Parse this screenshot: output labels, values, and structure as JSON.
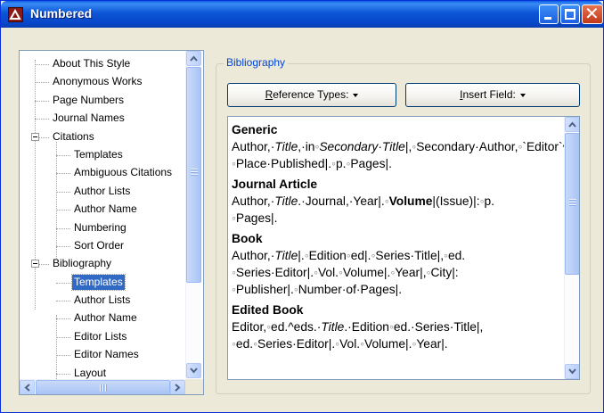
{
  "window": {
    "title": "Numbered"
  },
  "tree": {
    "items": [
      {
        "label": "About This Style",
        "level": 1
      },
      {
        "label": "Anonymous Works",
        "level": 1
      },
      {
        "label": "Page Numbers",
        "level": 1
      },
      {
        "label": "Journal Names",
        "level": 1
      },
      {
        "label": "Citations",
        "level": 0,
        "expanded": true
      },
      {
        "label": "Templates",
        "level": 2
      },
      {
        "label": "Ambiguous Citations",
        "level": 2
      },
      {
        "label": "Author Lists",
        "level": 2
      },
      {
        "label": "Author Name",
        "level": 2
      },
      {
        "label": "Numbering",
        "level": 2
      },
      {
        "label": "Sort Order",
        "level": 2
      },
      {
        "label": "Bibliography",
        "level": 0,
        "expanded": true
      },
      {
        "label": "Templates",
        "level": 2,
        "selected": true
      },
      {
        "label": "Author Lists",
        "level": 2
      },
      {
        "label": "Author Name",
        "level": 2
      },
      {
        "label": "Editor Lists",
        "level": 2
      },
      {
        "label": "Editor Names",
        "level": 2
      },
      {
        "label": "Layout",
        "level": 2
      }
    ]
  },
  "group": {
    "label": "Bibliography"
  },
  "buttons": {
    "reference_types_underlined": "R",
    "reference_types_rest": "eference Types:",
    "insert_field_underlined": "I",
    "insert_field_rest": "nsert Field:"
  },
  "templates": {
    "generic_heading": "Generic",
    "journal_heading": "Journal Article",
    "book_heading": "Book",
    "edited_book_heading": "Edited Book"
  },
  "colors": {
    "titlebar": "#0a55d6",
    "selection": "#316ac5",
    "group_label": "#0046d5",
    "window_face": "#ece9d8"
  }
}
